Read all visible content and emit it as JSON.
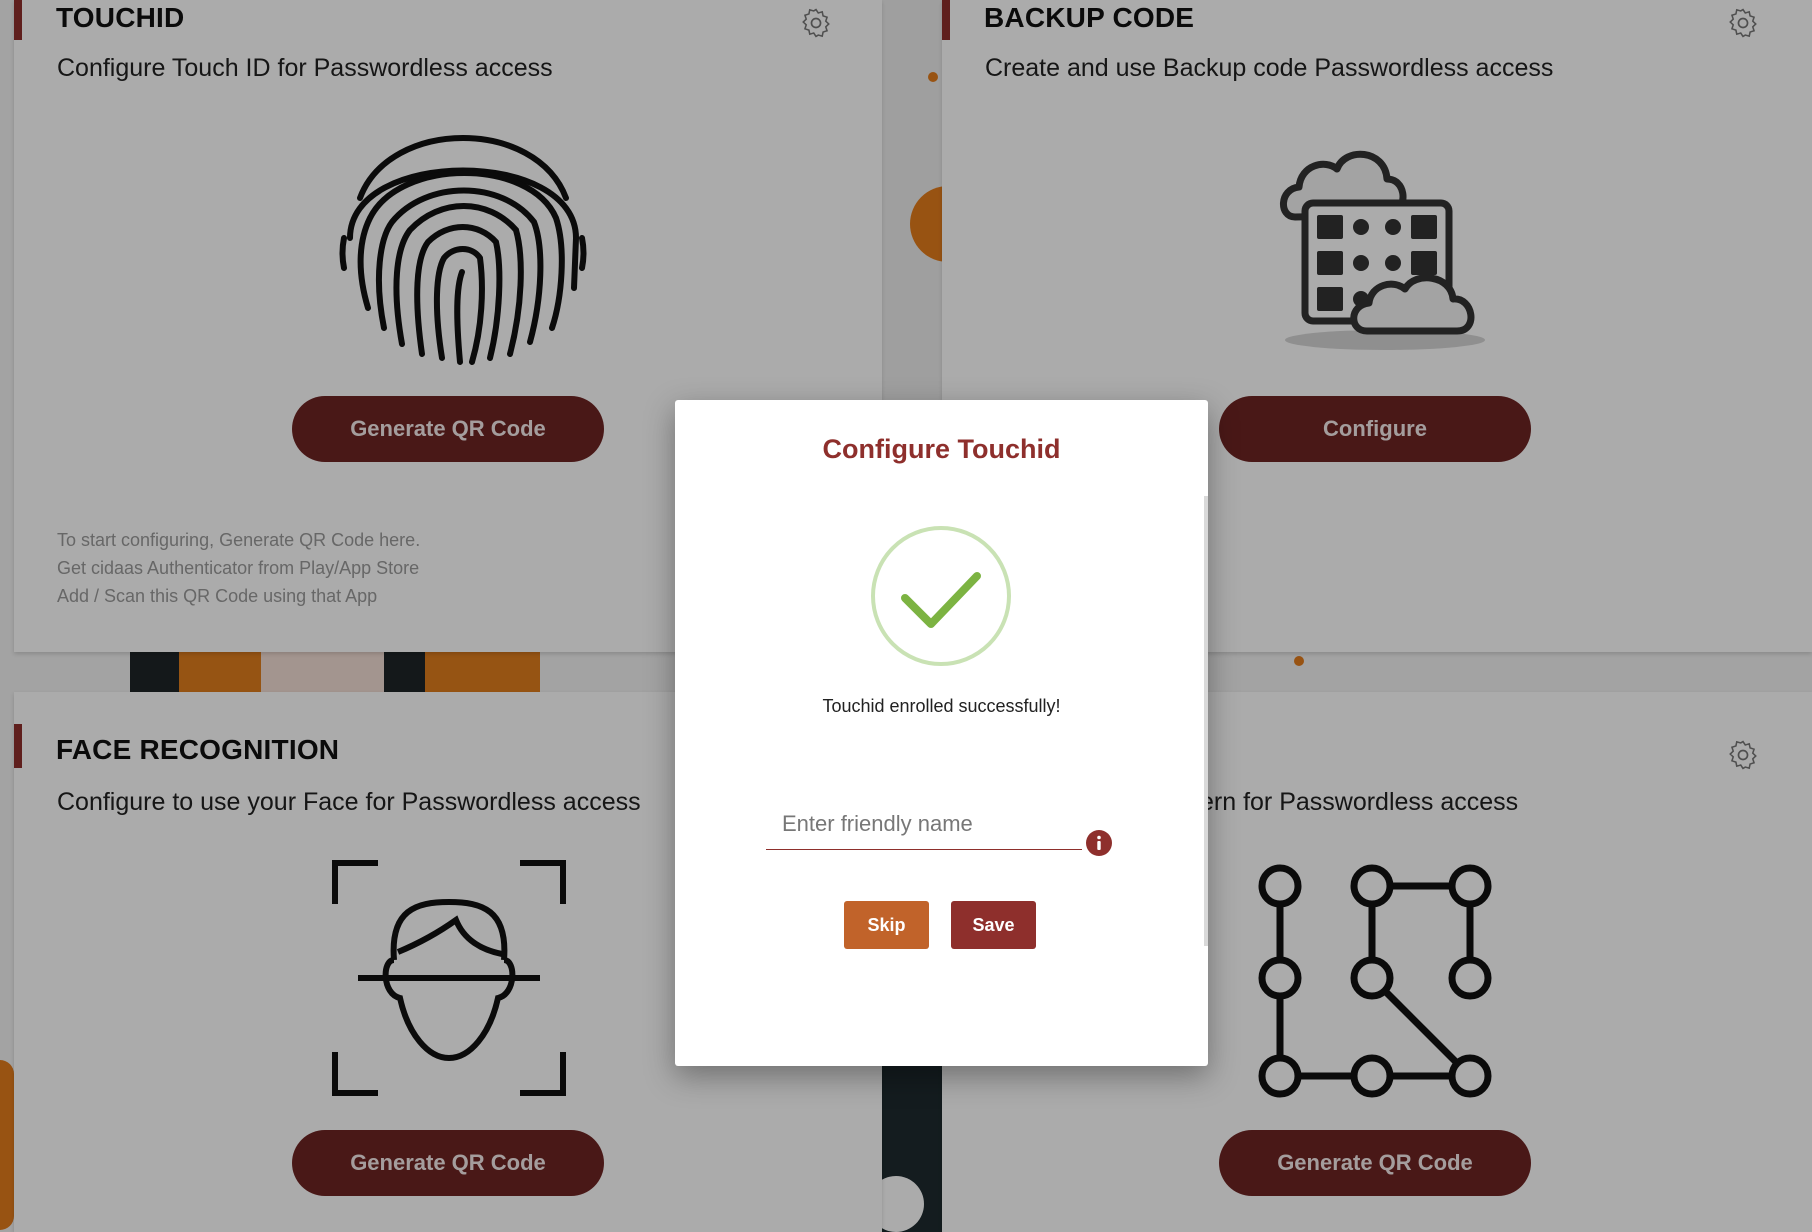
{
  "cards": [
    {
      "title": "TOUCHID",
      "subtitle": "Configure Touch ID for Passwordless access",
      "button": "Generate QR Code",
      "instructions": [
        "To start configuring, Generate QR Code here.",
        "Get cidaas Authenticator from Play/App Store",
        "Add / Scan this QR Code using that App"
      ],
      "illustration": "fingerprint-icon"
    },
    {
      "title": "BACKUP CODE",
      "subtitle": "Create and use Backup code Passwordless access",
      "button": "Configure",
      "illustration": "server-cloud-icon"
    },
    {
      "title": "FACE RECOGNITION",
      "subtitle": "Configure to use your Face for Passwordless access",
      "button": "Generate QR Code",
      "illustration": "face-scan-icon"
    },
    {
      "subtitle_partial": "ern for Passwordless access",
      "button": "Generate QR Code",
      "illustration": "pattern-lock-icon"
    }
  ],
  "modal": {
    "title": "Configure Touchid",
    "success_message": "Touchid enrolled successfully!",
    "name_placeholder": "Enter friendly name",
    "skip_label": "Skip",
    "save_label": "Save"
  },
  "colors": {
    "accent": "#8e2f2c",
    "button_dark": "#6e2423",
    "skip": "#c1632a",
    "success_green": "#7cb342"
  }
}
